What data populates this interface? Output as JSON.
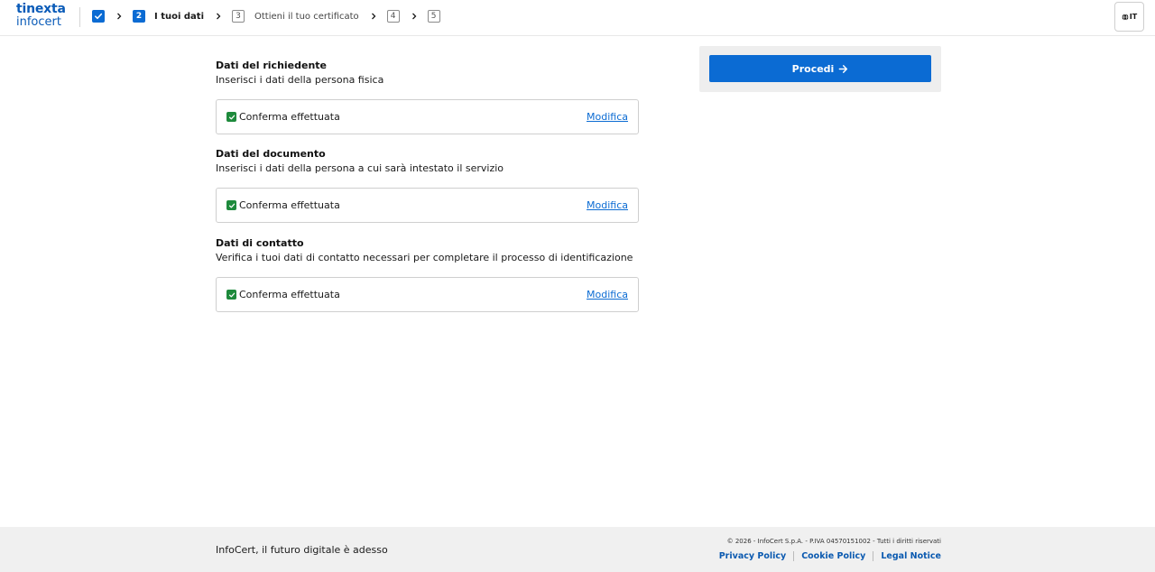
{
  "brand": {
    "line1": "tinexta",
    "line2": "infocert"
  },
  "stepper": {
    "step1_state": "completed",
    "step2_number": "2",
    "step2_label": "I tuoi dati",
    "step3_number": "3",
    "step3_label": "Ottieni il tuo certificato",
    "step4_number": "4",
    "step5_number": "5"
  },
  "language": {
    "label": "IT",
    "icon": "globe-icon"
  },
  "sections": [
    {
      "title": "Dati del richiedente",
      "description": "Inserisci i dati della persona fisica",
      "status": "Conferma effettuata",
      "action": "Modifica"
    },
    {
      "title": "Dati del documento",
      "description": "Inserisci i dati della persona a cui sarà intestato il servizio",
      "status": "Conferma effettuata",
      "action": "Modifica"
    },
    {
      "title": "Dati di contatto",
      "description": "Verifica i tuoi dati di contatto necessari per completare il processo di identificazione",
      "status": "Conferma effettuata",
      "action": "Modifica"
    }
  ],
  "proceed": {
    "label": "Procedi",
    "icon": "arrow-right-icon"
  },
  "footer": {
    "tagline": "InfoCert, il futuro digitale è adesso",
    "copyright": "© 2026 - InfoCert S.p.A. - P.IVA 04570151002 - Tutti i diritti riservati",
    "links": [
      "Privacy Policy",
      "Cookie Policy",
      "Legal Notice"
    ]
  },
  "colors": {
    "primary": "#0b6bd3",
    "brand": "#0a5bb8",
    "success": "#1e8a3c",
    "footer_bg": "#f0f0f0",
    "panel_bg": "#eeeeee"
  }
}
